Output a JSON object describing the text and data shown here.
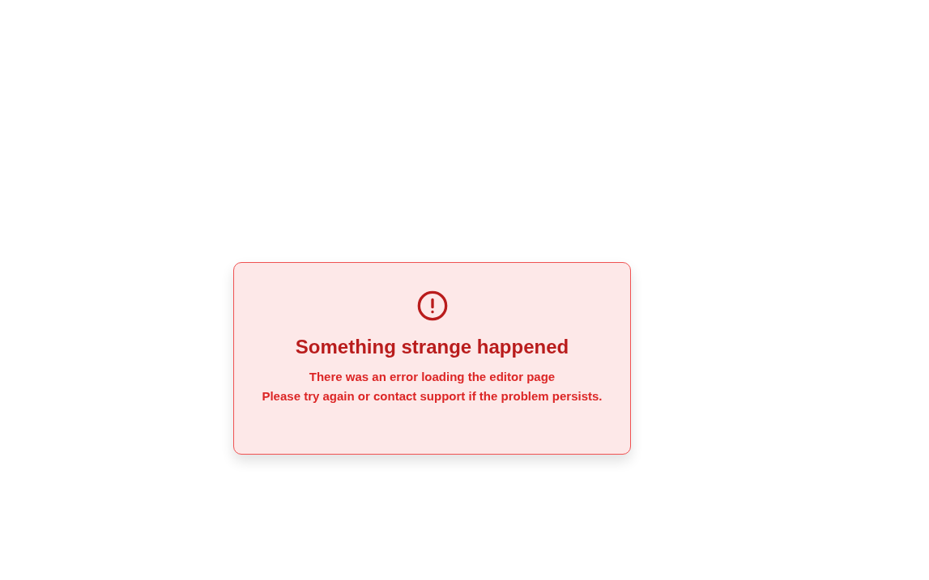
{
  "error_card": {
    "title": "Something strange happened",
    "messages": [
      "There was an error loading the editor page",
      "Please try again or contact support if the problem persists."
    ]
  }
}
